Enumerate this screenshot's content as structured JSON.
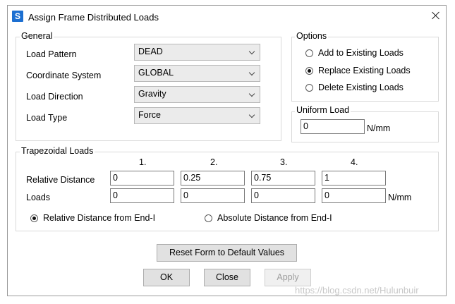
{
  "window": {
    "app_icon_letter": "S",
    "title": "Assign Frame Distributed Loads"
  },
  "general": {
    "title": "General",
    "fields": [
      {
        "label": "Load Pattern",
        "value": "DEAD"
      },
      {
        "label": "Coordinate System",
        "value": "GLOBAL"
      },
      {
        "label": "Load Direction",
        "value": "Gravity"
      },
      {
        "label": "Load Type",
        "value": "Force"
      }
    ]
  },
  "options": {
    "title": "Options",
    "items": [
      {
        "label": "Add to Existing Loads",
        "selected": false
      },
      {
        "label": "Replace Existing Loads",
        "selected": true
      },
      {
        "label": "Delete Existing Loads",
        "selected": false
      }
    ]
  },
  "uniform": {
    "title": "Uniform Load",
    "value": "0",
    "unit": "N/mm"
  },
  "trapezoidal": {
    "title": "Trapezoidal Loads",
    "columns": [
      "1.",
      "2.",
      "3.",
      "4."
    ],
    "rel_label": "Relative Distance",
    "rel_values": [
      "0",
      "0.25",
      "0.75",
      "1"
    ],
    "loads_label": "Loads",
    "load_values": [
      "0",
      "0",
      "0",
      "0"
    ],
    "unit": "N/mm",
    "distance_options": [
      {
        "label": "Relative Distance from End-I",
        "selected": true
      },
      {
        "label": "Absolute Distance from End-I",
        "selected": false
      }
    ]
  },
  "buttons": {
    "reset": "Reset Form to Default Values",
    "ok": "OK",
    "close": "Close",
    "apply": "Apply"
  },
  "watermark": "https://blog.csdn.net/Hulunbuir"
}
